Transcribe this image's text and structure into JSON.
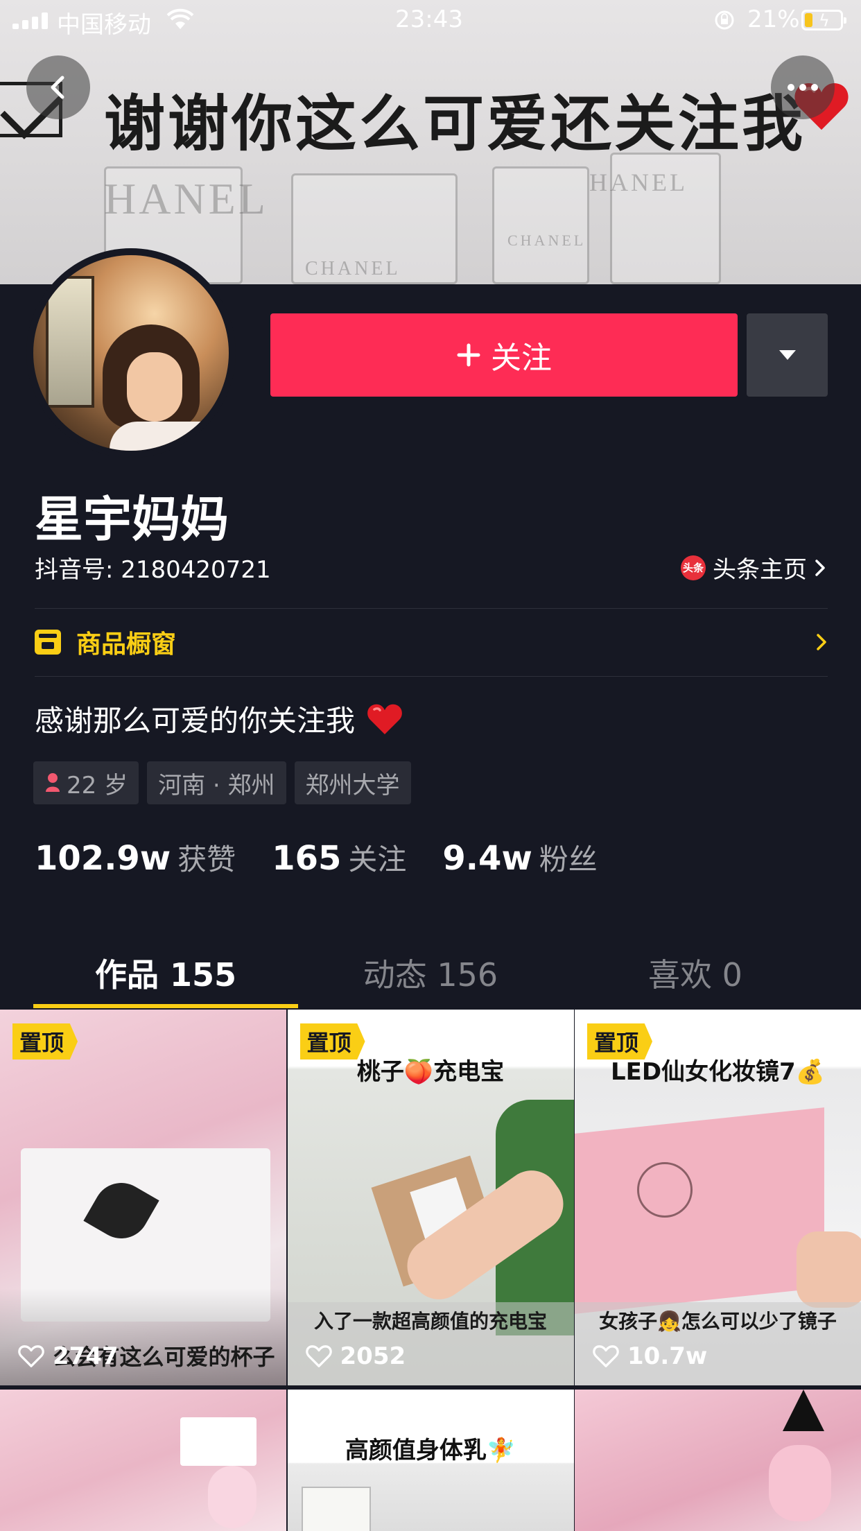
{
  "status_bar": {
    "carrier": "中国移动",
    "time": "23:43",
    "battery_percent": "21%"
  },
  "cover": {
    "text": "谢谢你这么可爱还关注我",
    "brand_words": [
      "HANEL",
      "CHANEL",
      "HANEL",
      "CHANEL"
    ]
  },
  "header": {
    "follow_label": "关注",
    "nickname": "星宇妈妈",
    "douyin_id": "抖音号: 2180420721",
    "toutiao_badge": "头条",
    "toutiao_link": "头条主页"
  },
  "shop": {
    "label": "商品橱窗"
  },
  "bio": {
    "text": "感谢那么可爱的你关注我"
  },
  "tags": [
    {
      "label": "22 岁",
      "icon": "female-icon"
    },
    {
      "label": "河南 · 郑州"
    },
    {
      "label": "郑州大学"
    }
  ],
  "stats": [
    {
      "value": "102.9w",
      "label": "获赞"
    },
    {
      "value": "165",
      "label": "关注"
    },
    {
      "value": "9.4w",
      "label": "粉丝"
    }
  ],
  "tabs": [
    {
      "label": "作品 155",
      "active": true
    },
    {
      "label": "动态 156",
      "active": false
    },
    {
      "label": "喜欢 0",
      "active": false
    }
  ],
  "videos": [
    {
      "pinned": "置顶",
      "title": "",
      "caption": "么会有这么可爱的杯子",
      "likes": "2747"
    },
    {
      "pinned": "置顶",
      "title": "桃子🍑充电宝",
      "caption": "入了一款超高颜值的充电宝",
      "likes": "2052"
    },
    {
      "pinned": "置顶",
      "title": "LED仙女化妆镜7💰",
      "caption": "女孩子👧怎么可以少了镜子",
      "likes": "10.7w"
    },
    {
      "title": ""
    },
    {
      "title": "高颜值身体乳🧚"
    },
    {
      "title": ""
    }
  ],
  "colors": {
    "background": "#161823",
    "follow_button": "#fe2c55",
    "accent_yellow": "#face15",
    "muted_text": "#a8a9ae"
  }
}
